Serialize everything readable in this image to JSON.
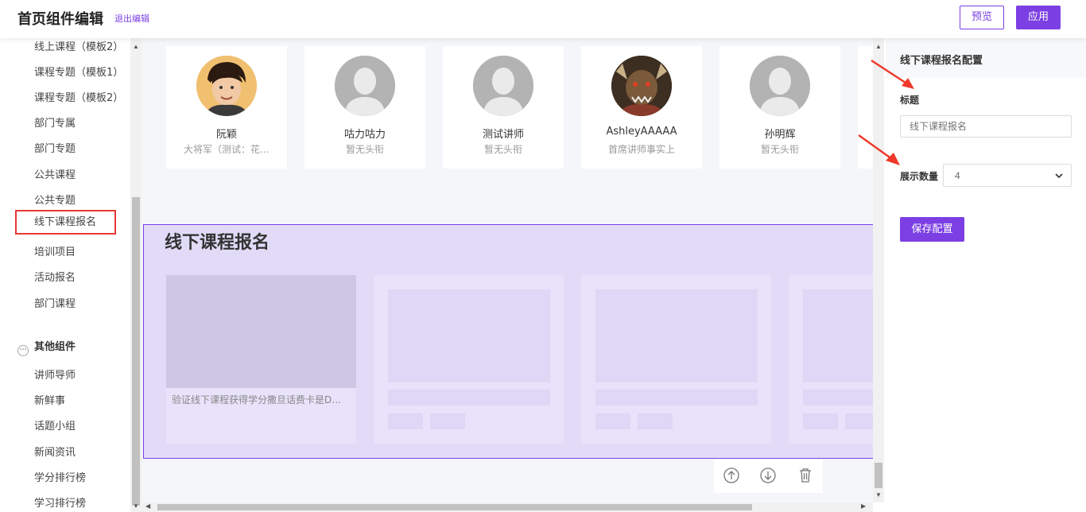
{
  "header": {
    "title": "首页组件编辑",
    "exit_link": "退出编辑",
    "preview_button": "预览",
    "apply_button": "应用"
  },
  "sidebar": {
    "items": [
      {
        "label": "线上课程（模板2）"
      },
      {
        "label": "课程专题（模板1）"
      },
      {
        "label": "课程专题（模板2）"
      },
      {
        "label": "部门专属"
      },
      {
        "label": "部门专题"
      },
      {
        "label": "公共课程"
      },
      {
        "label": "公共专题"
      },
      {
        "label": "线下课程报名",
        "active": true
      },
      {
        "label": "培训项目"
      },
      {
        "label": "活动报名"
      },
      {
        "label": "部门课程"
      }
    ],
    "group_title": "其他组件",
    "group_items": [
      {
        "label": "讲师导师"
      },
      {
        "label": "新鲜事"
      },
      {
        "label": "话题小组"
      },
      {
        "label": "新闻资讯"
      },
      {
        "label": "学分排行榜"
      },
      {
        "label": "学习排行榜"
      }
    ]
  },
  "lecturers": [
    {
      "name": "阮颖",
      "title": "大将军（测试：花…",
      "avatar": "photo-avatar-person"
    },
    {
      "name": "咕力咕力",
      "title": "暂无头衔",
      "avatar": "default-avatar"
    },
    {
      "name": "测试讲师",
      "title": "暂无头衔",
      "avatar": "default-avatar"
    },
    {
      "name": "AshleyAAAAA",
      "title": "首席讲师事实上",
      "avatar": "photo-avatar-monster"
    },
    {
      "name": "孙明辉",
      "title": "暂无头衔",
      "avatar": "default-avatar"
    }
  ],
  "offline_section": {
    "heading": "线下课程报名",
    "first_course_name": "验证线下课程获得学分撒旦话费卡是D…"
  },
  "panel": {
    "header": "线下课程报名配置",
    "title_label": "标题",
    "title_placeholder": "线下课程报名",
    "count_label": "展示数量",
    "count_value": "4",
    "save_button": "保存配置"
  },
  "colors": {
    "accent": "#7b3fe4",
    "highlight_border": "#e53935",
    "annotation_arrow": "#f0392b"
  }
}
